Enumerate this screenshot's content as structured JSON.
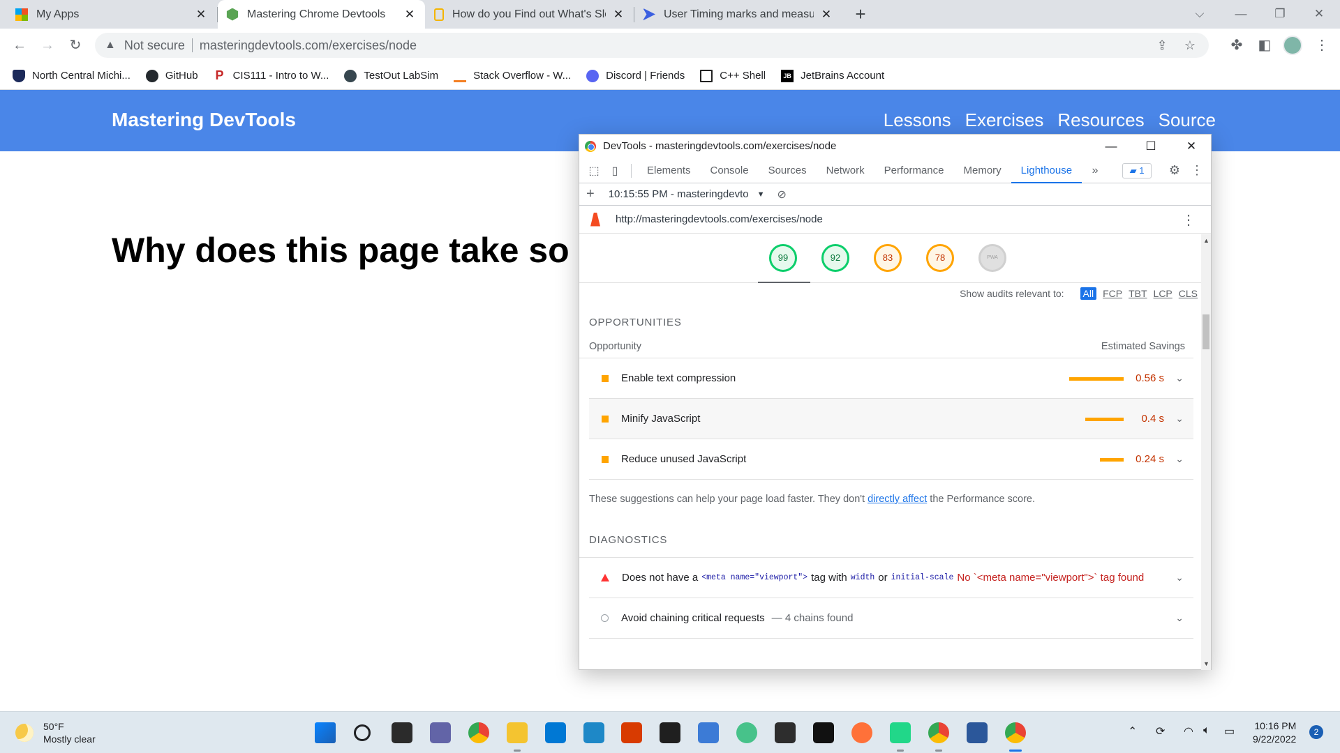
{
  "browser": {
    "tabs": [
      {
        "title": "My Apps",
        "color": "#f25022"
      },
      {
        "title": "Mastering Chrome Devtools",
        "color": "#5aa454"
      },
      {
        "title": "How do you Find out What's Slow",
        "color": "#f4b400"
      },
      {
        "title": "User Timing marks and measures",
        "color": "#3b5fe0"
      }
    ],
    "address": {
      "security": "Not secure",
      "url": "masteringdevtools.com/exercises/node"
    },
    "bookmarks": [
      {
        "label": "North Central Michi...",
        "color": "#1c2a5a"
      },
      {
        "label": "GitHub",
        "color": "#24292e"
      },
      {
        "label": "CIS111 - Intro to W...",
        "color": "#c62828"
      },
      {
        "label": "TestOut LabSim",
        "color": "#37474f"
      },
      {
        "label": "Stack Overflow - W...",
        "color": "#f48024"
      },
      {
        "label": "Discord | Friends",
        "color": "#5865f2"
      },
      {
        "label": "C++ Shell",
        "color": "#222222"
      },
      {
        "label": "JetBrains Account",
        "color": "#000000"
      }
    ]
  },
  "site": {
    "logo": "Mastering DevTools",
    "nav": [
      "Lessons",
      "Exercises",
      "Resources",
      "Source"
    ],
    "heading": "Why does this page take so"
  },
  "devtools": {
    "window_title": "DevTools - masteringdevtools.com/exercises/node",
    "tabs": [
      "Elements",
      "Console",
      "Sources",
      "Network",
      "Performance",
      "Memory",
      "Lighthouse"
    ],
    "active_tab": "Lighthouse",
    "issues_count": "1",
    "report_select": "10:15:55 PM - masteringdevto",
    "report_url": "http://masteringdevtools.com/exercises/node",
    "gauges": [
      {
        "score": "99",
        "status": "good"
      },
      {
        "score": "92",
        "status": "good"
      },
      {
        "score": "83",
        "status": "average"
      },
      {
        "score": "78",
        "status": "average"
      },
      {
        "score": "PWA",
        "status": "na"
      }
    ],
    "filter": {
      "label": "Show audits relevant to:",
      "options": [
        "All",
        "FCP",
        "TBT",
        "LCP",
        "CLS"
      ]
    },
    "opportunities": {
      "title": "OPPORTUNITIES",
      "col_left": "Opportunity",
      "col_right": "Estimated Savings",
      "items": [
        {
          "label": "Enable text compression",
          "savings": "0.56 s",
          "fraction": 1.0
        },
        {
          "label": "Minify JavaScript",
          "savings": "0.4 s",
          "fraction": 0.71
        },
        {
          "label": "Reduce unused JavaScript",
          "savings": "0.24 s",
          "fraction": 0.43
        }
      ],
      "note_before": "These suggestions can help your page load faster. They don't ",
      "note_link": "directly affect",
      "note_after": " the Performance score."
    },
    "diagnostics": {
      "title": "DIAGNOSTICS",
      "viewport": {
        "text1": "Does not have a",
        "code1": "<meta name=\"viewport\">",
        "text2": "tag with",
        "code2": "width",
        "text3": "or",
        "code3": "initial-scale",
        "fail": "No `<meta name=\"viewport\">` tag found"
      },
      "chains": {
        "label": "Avoid chaining critical requests",
        "detail": "— 4 chains found"
      }
    }
  },
  "taskbar": {
    "weather_temp": "50°F",
    "weather_desc": "Mostly clear",
    "time": "10:16 PM",
    "date": "9/22/2022",
    "notifications": "2"
  }
}
